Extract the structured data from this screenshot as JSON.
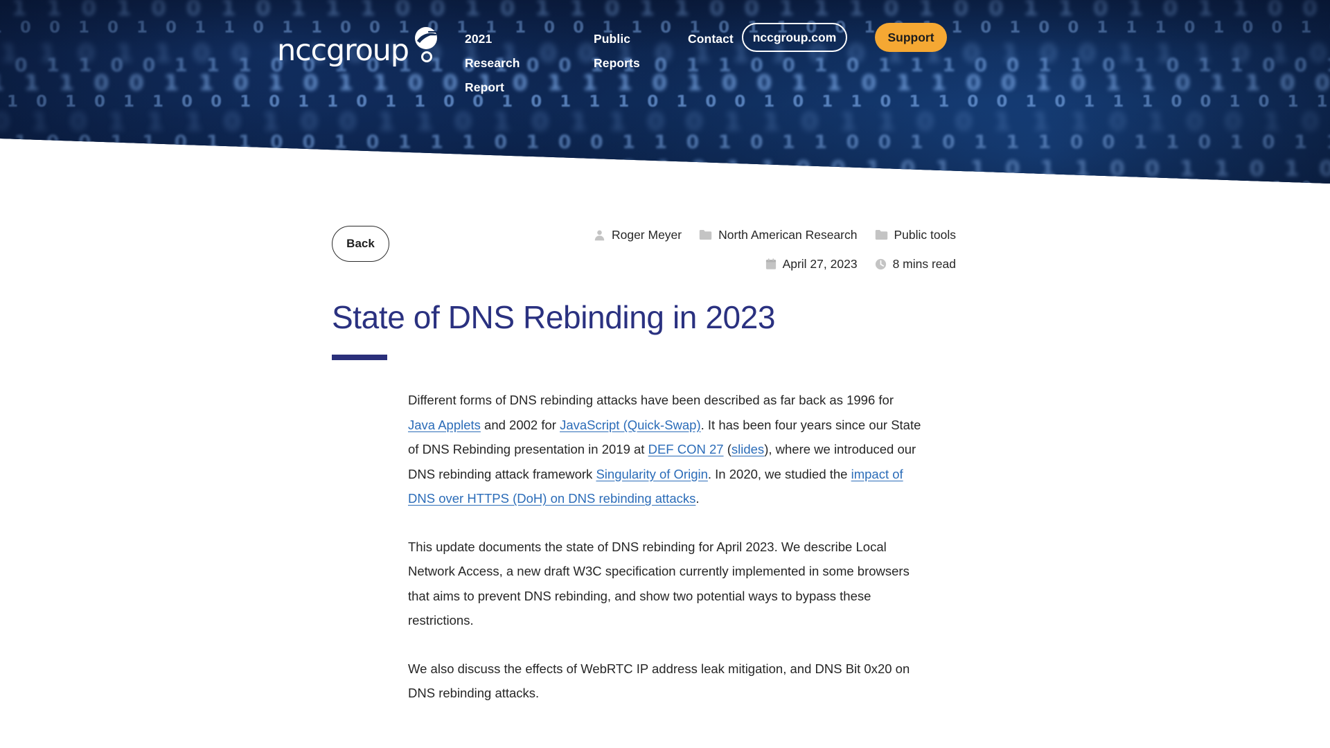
{
  "header": {
    "logo_text": "nccgroup",
    "logo_icon": "nccgroup-swoosh-logo",
    "nav": [
      {
        "id": "research",
        "label": "2021 Research\nReport"
      },
      {
        "id": "public",
        "label": "Public\nReports"
      },
      {
        "id": "contact",
        "label": "Contact"
      }
    ],
    "domain_button": "nccgroup.com",
    "support_button": "Support"
  },
  "article": {
    "back_label": "Back",
    "author": "Roger Meyer",
    "category": "North American Research",
    "tag": "Public tools",
    "date": "April 27, 2023",
    "read_time": "8 mins read",
    "title": "State of DNS Rebinding in 2023",
    "paragraphs": [
      {
        "parts": [
          {
            "t": "Different forms of DNS rebinding attacks have been described as far back as 1996 for "
          },
          {
            "t": "Java Applets",
            "link": true
          },
          {
            "t": " and 2002 for "
          },
          {
            "t": "JavaScript (Quick-Swap)",
            "link": true
          },
          {
            "t": ". It has been four years since our State of DNS Rebinding presentation in 2019 at "
          },
          {
            "t": "DEF CON 27",
            "link": true
          },
          {
            "t": " ("
          },
          {
            "t": "slides",
            "link": true
          },
          {
            "t": "), where we introduced our DNS rebinding attack framework "
          },
          {
            "t": "Singularity of Origin",
            "link": true
          },
          {
            "t": ". In 2020, we studied the "
          },
          {
            "t": "impact of DNS over HTTPS (DoH) on DNS rebinding attacks",
            "link": true
          },
          {
            "t": "."
          }
        ]
      },
      {
        "parts": [
          {
            "t": "This update documents the state of DNS rebinding for April 2023. We describe Local Network Access, a new draft W3C specification currently implemented in some browsers that aims to prevent DNS rebinding, and show two potential ways to bypass these restrictions."
          }
        ]
      },
      {
        "parts": [
          {
            "t": "We also discuss the effects of WebRTC IP address leak mitigation, and DNS Bit 0x20 on DNS rebinding attacks."
          }
        ]
      }
    ]
  },
  "colors": {
    "hero_dark": "#091734",
    "hero_blue": "#17427f",
    "binary_glyph": "#7ba9e8",
    "support_orange": "#f5a833",
    "title_navy": "#2a3180",
    "rule_navy": "#2a2f7a",
    "link_blue": "#2b6cb8",
    "body_text": "#262626",
    "meta_icon_grey": "#c4c4c4"
  },
  "hero": {
    "binary_rows": [
      "1 0 0 1 0 1 1 1 1 1 1 1 0 0 1 1 1 1 1 1 1 0 0 1 0 1 1 0 1 0 0 1 1 1 0 1 0 1 1 0 0 1 0 1 1 1 0 0 1 1 0 1 0 1 1 0 0 1 0 1 1 1 0 0 1 0 1 1",
      "0 1 1 0 1 0 0 1 0 1 1 1 0 0 1 0 1 1 0 1 1 0 0 1 1 1 0 1 0 0 1 1 0 1 0 1 1 0 0 1 0 1 1 1 0 0 1 1 0 1 0 0 1 1 1 0 1 0 0 1 0 1 1 0 1 1 0 0",
      "1 1 0 0 1 0 1 0 1 1 0 1 1 0 0 1 0 1 1 1 0 0 1 1 0 1 0 1 1 0 0 1 0 1 1 0 1 0 0 1 1 1 0 1 0 0 1 0 1 1 0 1 1 0 0 1 0 1 1 1 0 0 1 0 1 1 0 1",
      "0 0 1 1 0 1 1 0 0 1 1 0 1 0 1 1 0 0 1 0 1 1 1 0 0 1 1 0 1 0 0 1 1 1 0 1 0 1 1 0 0 1 0 1 1 0 1 0 0 1 1 1 0 0 1 0 1 1 0 1 1 0 0 1 0 1 1 1",
      "1 0 1 0 1 1 0 0 1 1 1 0 0 1 0 1 1 0 1 0 0 1 1 0 1 1 0 0 1 0 1 1 1 0 0 1 1 0 1 0 1 1 0 0 1 0 1 1 0 1 1 0 0 1 1 1 0 0 1 0 1 1 0 1 0 0 1 1",
      "0 1 1 1 0 0 1 1 0 1 0 1 1 0 0 1 0 1 1 1 0 1 0 0 1 1 0 1 1 0 0 1 0 1 1 0 1 1 0 0 1 0 1 1 1 0 0 1 1 0 1 0 1 1 0 0 1 1 0 1 0 0 1 1 1 0 1 0",
      "1 1 0 1 0 1 1 0 0 1 0 1 1 0 1 1 0 0 1 0 1 1 1 0 1 0 0 1 0 1 1 0 1 1 0 0 1 0 1 1 1 0 0 1 0 1 1 0 1 0 1 1 0 0 1 0 1 1 1 0 0 1 1 0 1 0 1 1",
      "0 0 1 0 1 1 1 0 1 0 0 1 1 0 1 0 1 1 0 0 1 1 0 1 1 0 0 1 1 1 0 1 0 0 1 0 1 1 0 1 0 0 1 1 0 1 1 0 0 1 0 1 1 1 0 1 0 0 1 1 0 1 0 1 1 0 0 1",
      "1 0 1 1 0 0 1 1 0 1 1 0 0 1 0 1 1 1 0 1 0 0 1 1 0 1 0 1 1 0 0 1 0 1 1 1 0 0 1 1 0 1 0 1 1 0 0 1 1 0 1 0 0 1 1 1 0 1 0 0 1 0 1 1 0 1 1 0",
      "1 1 0 0 1 1 1 0 0 1 0 1 1 0 1 0 0 1 1 1 0 1 0 1 1 0 0 1 0 1 1 0 1 1 0 0 1 1 0 1 0 1 1 0 0 1 0 1 1 1 0 1 0 0 1 1 0 1 0 1 1 0 0 1 0 1 1 1"
    ]
  }
}
